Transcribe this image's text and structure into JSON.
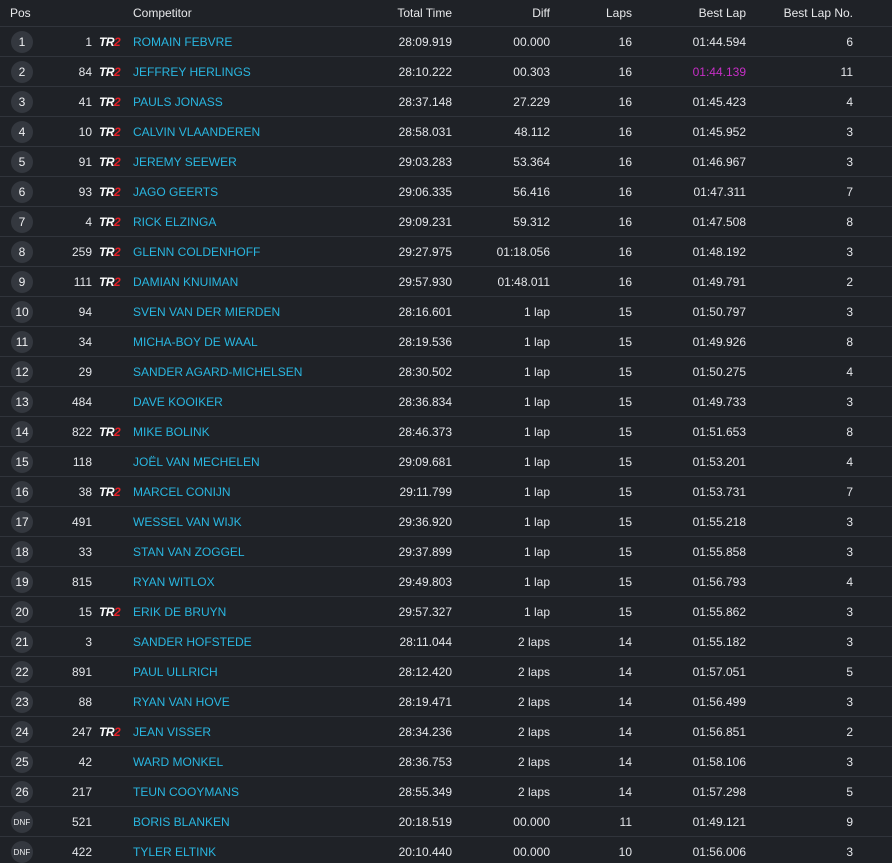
{
  "headers": {
    "pos": "Pos",
    "competitor": "Competitor",
    "total_time": "Total Time",
    "diff": "Diff",
    "laps": "Laps",
    "best_lap": "Best Lap",
    "best_lap_no": "Best Lap No."
  },
  "badge": {
    "prefix": "TR",
    "digit": "2"
  },
  "colors": {
    "background": "#1f2227",
    "name": "#29b6e0",
    "best_overall": "#c52fc5",
    "badge_red": "#e21f26"
  },
  "rows": [
    {
      "pos": "1",
      "number": "1",
      "tr2": true,
      "name": "ROMAIN FEBVRE",
      "total": "28:09.919",
      "diff": "00.000",
      "laps": "16",
      "best": "01:44.594",
      "best_no": "6"
    },
    {
      "pos": "2",
      "number": "84",
      "tr2": true,
      "name": "JEFFREY HERLINGS",
      "total": "28:10.222",
      "diff": "00.303",
      "laps": "16",
      "best": "01:44.139",
      "best_no": "11",
      "best_overall": true
    },
    {
      "pos": "3",
      "number": "41",
      "tr2": true,
      "name": "PAULS JONASS",
      "total": "28:37.148",
      "diff": "27.229",
      "laps": "16",
      "best": "01:45.423",
      "best_no": "4"
    },
    {
      "pos": "4",
      "number": "10",
      "tr2": true,
      "name": "CALVIN VLAANDEREN",
      "total": "28:58.031",
      "diff": "48.112",
      "laps": "16",
      "best": "01:45.952",
      "best_no": "3"
    },
    {
      "pos": "5",
      "number": "91",
      "tr2": true,
      "name": "JEREMY SEEWER",
      "total": "29:03.283",
      "diff": "53.364",
      "laps": "16",
      "best": "01:46.967",
      "best_no": "3"
    },
    {
      "pos": "6",
      "number": "93",
      "tr2": true,
      "name": "JAGO GEERTS",
      "total": "29:06.335",
      "diff": "56.416",
      "laps": "16",
      "best": "01:47.311",
      "best_no": "7"
    },
    {
      "pos": "7",
      "number": "4",
      "tr2": true,
      "name": "RICK ELZINGA",
      "total": "29:09.231",
      "diff": "59.312",
      "laps": "16",
      "best": "01:47.508",
      "best_no": "8"
    },
    {
      "pos": "8",
      "number": "259",
      "tr2": true,
      "name": "GLENN COLDENHOFF",
      "total": "29:27.975",
      "diff": "01:18.056",
      "laps": "16",
      "best": "01:48.192",
      "best_no": "3"
    },
    {
      "pos": "9",
      "number": "111",
      "tr2": true,
      "name": "DAMIAN KNUIMAN",
      "total": "29:57.930",
      "diff": "01:48.011",
      "laps": "16",
      "best": "01:49.791",
      "best_no": "2"
    },
    {
      "pos": "10",
      "number": "94",
      "tr2": false,
      "name": "SVEN VAN DER MIERDEN",
      "total": "28:16.601",
      "diff": "1 lap",
      "laps": "15",
      "best": "01:50.797",
      "best_no": "3"
    },
    {
      "pos": "11",
      "number": "34",
      "tr2": false,
      "name": "MICHA-BOY DE WAAL",
      "total": "28:19.536",
      "diff": "1 lap",
      "laps": "15",
      "best": "01:49.926",
      "best_no": "8"
    },
    {
      "pos": "12",
      "number": "29",
      "tr2": false,
      "name": "SANDER AGARD-MICHELSEN",
      "total": "28:30.502",
      "diff": "1 lap",
      "laps": "15",
      "best": "01:50.275",
      "best_no": "4"
    },
    {
      "pos": "13",
      "number": "484",
      "tr2": false,
      "name": "DAVE KOOIKER",
      "total": "28:36.834",
      "diff": "1 lap",
      "laps": "15",
      "best": "01:49.733",
      "best_no": "3"
    },
    {
      "pos": "14",
      "number": "822",
      "tr2": true,
      "name": "MIKE BOLINK",
      "total": "28:46.373",
      "diff": "1 lap",
      "laps": "15",
      "best": "01:51.653",
      "best_no": "8"
    },
    {
      "pos": "15",
      "number": "118",
      "tr2": false,
      "name": "JOËL VAN MECHELEN",
      "total": "29:09.681",
      "diff": "1 lap",
      "laps": "15",
      "best": "01:53.201",
      "best_no": "4"
    },
    {
      "pos": "16",
      "number": "38",
      "tr2": true,
      "name": "MARCEL CONIJN",
      "total": "29:11.799",
      "diff": "1 lap",
      "laps": "15",
      "best": "01:53.731",
      "best_no": "7"
    },
    {
      "pos": "17",
      "number": "491",
      "tr2": false,
      "name": "WESSEL VAN WIJK",
      "total": "29:36.920",
      "diff": "1 lap",
      "laps": "15",
      "best": "01:55.218",
      "best_no": "3"
    },
    {
      "pos": "18",
      "number": "33",
      "tr2": false,
      "name": "STAN VAN ZOGGEL",
      "total": "29:37.899",
      "diff": "1 lap",
      "laps": "15",
      "best": "01:55.858",
      "best_no": "3"
    },
    {
      "pos": "19",
      "number": "815",
      "tr2": false,
      "name": "RYAN WITLOX",
      "total": "29:49.803",
      "diff": "1 lap",
      "laps": "15",
      "best": "01:56.793",
      "best_no": "4"
    },
    {
      "pos": "20",
      "number": "15",
      "tr2": true,
      "name": "ERIK DE BRUYN",
      "total": "29:57.327",
      "diff": "1 lap",
      "laps": "15",
      "best": "01:55.862",
      "best_no": "3"
    },
    {
      "pos": "21",
      "number": "3",
      "tr2": false,
      "name": "SANDER HOFSTEDE",
      "total": "28:11.044",
      "diff": "2 laps",
      "laps": "14",
      "best": "01:55.182",
      "best_no": "3"
    },
    {
      "pos": "22",
      "number": "891",
      "tr2": false,
      "name": "PAUL ULLRICH",
      "total": "28:12.420",
      "diff": "2 laps",
      "laps": "14",
      "best": "01:57.051",
      "best_no": "5"
    },
    {
      "pos": "23",
      "number": "88",
      "tr2": false,
      "name": "RYAN VAN HOVE",
      "total": "28:19.471",
      "diff": "2 laps",
      "laps": "14",
      "best": "01:56.499",
      "best_no": "3"
    },
    {
      "pos": "24",
      "number": "247",
      "tr2": true,
      "name": "JEAN VISSER",
      "total": "28:34.236",
      "diff": "2 laps",
      "laps": "14",
      "best": "01:56.851",
      "best_no": "2"
    },
    {
      "pos": "25",
      "number": "42",
      "tr2": false,
      "name": "WARD MONKEL",
      "total": "28:36.753",
      "diff": "2 laps",
      "laps": "14",
      "best": "01:58.106",
      "best_no": "3"
    },
    {
      "pos": "26",
      "number": "217",
      "tr2": false,
      "name": "TEUN COOYMANS",
      "total": "28:55.349",
      "diff": "2 laps",
      "laps": "14",
      "best": "01:57.298",
      "best_no": "5"
    },
    {
      "pos": "DNF",
      "number": "521",
      "tr2": false,
      "name": "BORIS BLANKEN",
      "total": "20:18.519",
      "diff": "00.000",
      "laps": "11",
      "best": "01:49.121",
      "best_no": "9"
    },
    {
      "pos": "DNF",
      "number": "422",
      "tr2": false,
      "name": "TYLER ELTINK",
      "total": "20:10.440",
      "diff": "00.000",
      "laps": "10",
      "best": "01:56.006",
      "best_no": "3"
    }
  ]
}
